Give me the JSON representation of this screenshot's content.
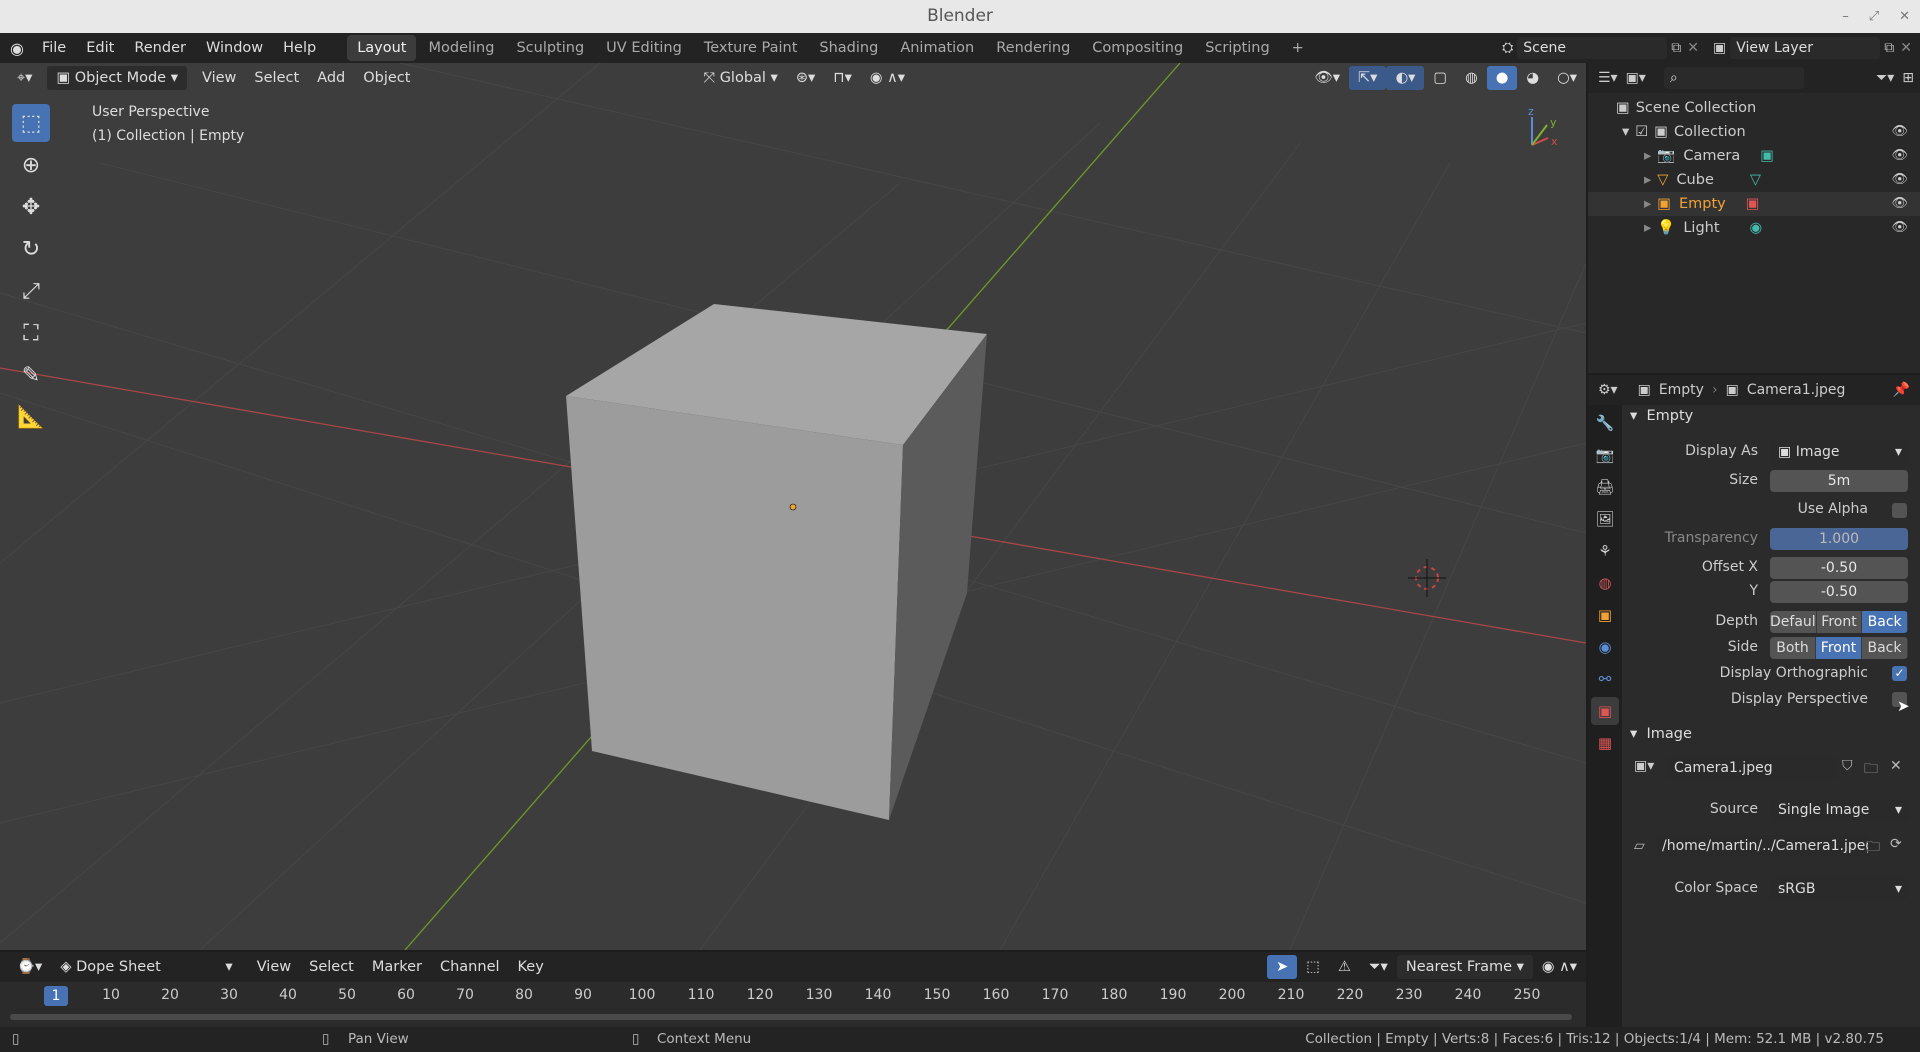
{
  "window": {
    "title": "Blender"
  },
  "menus": [
    "File",
    "Edit",
    "Render",
    "Window",
    "Help"
  ],
  "workspaces": [
    "Layout",
    "Modeling",
    "Sculpting",
    "UV Editing",
    "Texture Paint",
    "Shading",
    "Animation",
    "Rendering",
    "Compositing",
    "Scripting"
  ],
  "active_workspace": "Layout",
  "scene": "Scene",
  "view_layer": "View Layer",
  "viewport": {
    "mode": "Object Mode",
    "menus": [
      "View",
      "Select",
      "Add",
      "Object"
    ],
    "transform_orientation": "Global",
    "overlay_title": "User Perspective",
    "overlay_sub": "(1) Collection | Empty",
    "axis_labels": {
      "x": "x",
      "y": "y",
      "z": "z"
    }
  },
  "outliner": {
    "root": "Scene Collection",
    "collection": "Collection",
    "items": [
      {
        "name": "Camera",
        "color": "#cccccc"
      },
      {
        "name": "Cube",
        "color": "#cccccc"
      },
      {
        "name": "Empty",
        "color": "#f0a236"
      },
      {
        "name": "Light",
        "color": "#cccccc"
      }
    ]
  },
  "properties": {
    "object_name": "Empty",
    "data_name": "Camera1.jpeg",
    "panel_empty": "Empty",
    "display_as_label": "Display As",
    "display_as": "Image",
    "size_label": "Size",
    "size": "5m",
    "use_alpha_label": "Use Alpha",
    "use_alpha": false,
    "transparency_label": "Transparency",
    "transparency": "1.000",
    "offset_x_label": "Offset X",
    "offset_x": "-0.50",
    "offset_y_label": "Y",
    "offset_y": "-0.50",
    "depth_label": "Depth",
    "depth_options": [
      "Defaul",
      "Front",
      "Back"
    ],
    "depth_selected": "Back",
    "side_label": "Side",
    "side_options": [
      "Both",
      "Front",
      "Back"
    ],
    "side_selected": "Front",
    "display_ortho_label": "Display Orthographic",
    "display_ortho": true,
    "display_persp_label": "Display Perspective",
    "display_persp": false,
    "panel_image": "Image",
    "image_name": "Camera1.jpeg",
    "source_label": "Source",
    "source": "Single Image",
    "filepath": "/home/martin/../Camera1.jpeg",
    "colorspace_label": "Color Space",
    "colorspace": "sRGB"
  },
  "dopesheet": {
    "editor": "Dope Sheet",
    "menus": [
      "View",
      "Select",
      "Marker",
      "Channel",
      "Key"
    ],
    "snap": "Nearest Frame",
    "current_frame": "1",
    "ticks": [
      "10",
      "20",
      "30",
      "40",
      "50",
      "60",
      "70",
      "80",
      "90",
      "100",
      "110",
      "120",
      "130",
      "140",
      "150",
      "160",
      "170",
      "180",
      "190",
      "200",
      "210",
      "220",
      "230",
      "240",
      "250"
    ]
  },
  "status": {
    "pan": "Pan View",
    "context": "Context Menu",
    "stats": "Collection | Empty | Verts:8 | Faces:6 | Tris:12 | Objects:1/4 | Mem: 52.1 MB | v2.80.75"
  }
}
